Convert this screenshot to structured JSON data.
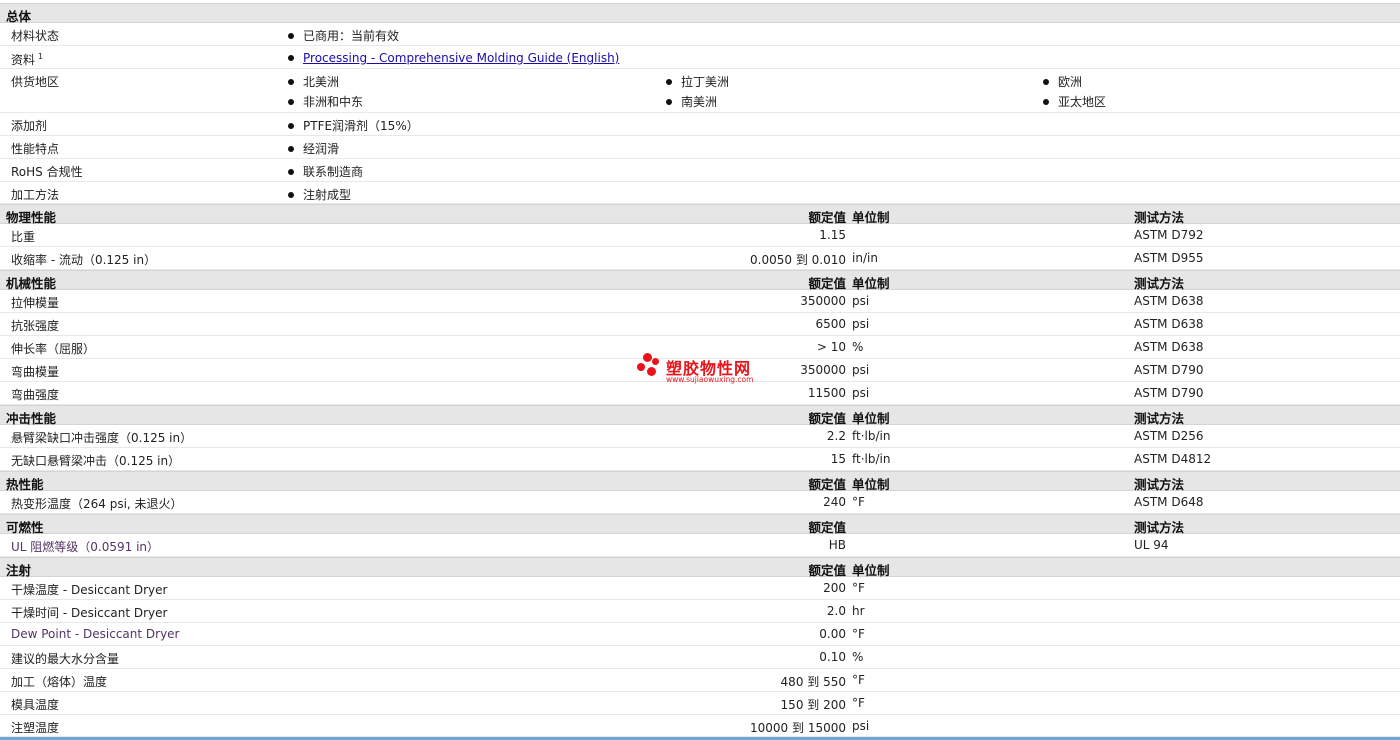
{
  "sections": {
    "general": "总体",
    "physical": "物理性能",
    "mechanical": "机械性能",
    "impact": "冲击性能",
    "thermal": "热性能",
    "flammability": "可燃性",
    "injection": "注射"
  },
  "columns": {
    "rated_value": "额定值",
    "unit_system": "单位制",
    "test_method": "测试方法"
  },
  "general": {
    "material_status_label": "材料状态",
    "material_status_value": "已商用：当前有效",
    "documents_label": "资料",
    "documents_sup": "1",
    "documents_link": "Processing - Comprehensive Molding Guide (English)",
    "regions_label": "供货地区",
    "regions": [
      "北美洲",
      "拉丁美洲",
      "欧洲",
      "非洲和中东",
      "南美洲",
      "亚太地区"
    ],
    "additive_label": "添加剂",
    "additive_value": "PTFE润滑剂（15%）",
    "features_label": "性能特点",
    "features_value": "经润滑",
    "rohs_label": "RoHS 合规性",
    "rohs_value": "联系制造商",
    "processing_label": "加工方法",
    "processing_value": "注射成型"
  },
  "physical_rows": [
    {
      "label": "比重",
      "value": "1.15",
      "unit": "",
      "method": "ASTM D792"
    },
    {
      "label": "收缩率  - 流动（0.125 in）",
      "value": "0.0050 到  0.010",
      "unit": "in/in",
      "method": "ASTM D955"
    }
  ],
  "mechanical_rows": [
    {
      "label": "拉伸模量",
      "value": "350000",
      "unit": "psi",
      "method": "ASTM D638"
    },
    {
      "label": "抗张强度",
      "value": "6500",
      "unit": "psi",
      "method": "ASTM D638"
    },
    {
      "label": "伸长率（屈服）",
      "value": "> 10",
      "unit": "%",
      "method": "ASTM D638"
    },
    {
      "label": "弯曲模量",
      "value": "350000",
      "unit": "psi",
      "method": "ASTM D790"
    },
    {
      "label": "弯曲强度",
      "value": "11500",
      "unit": "psi",
      "method": "ASTM D790"
    }
  ],
  "impact_rows": [
    {
      "label": "悬臂梁缺口冲击强度（0.125 in）",
      "value": "2.2",
      "unit": "ft·lb/in",
      "method": "ASTM D256"
    },
    {
      "label": "无缺口悬臂梁冲击（0.125 in）",
      "value": "15",
      "unit": "ft·lb/in",
      "method": "ASTM D4812"
    }
  ],
  "thermal_rows": [
    {
      "label": "热变形温度（264 psi, 未退火）",
      "value": "240",
      "unit": "°F",
      "method": "ASTM D648"
    }
  ],
  "flammability_rows": [
    {
      "label": "UL 阻燃等级（0.0591 in）",
      "value": "HB",
      "unit": "",
      "method": "UL 94"
    }
  ],
  "injection_rows": [
    {
      "label": "干燥温度  - Desiccant Dryer",
      "value": "200",
      "unit": "°F"
    },
    {
      "label": "干燥时间  - Desiccant Dryer",
      "value": "2.0",
      "unit": "hr"
    },
    {
      "label": "Dew Point - Desiccant Dryer",
      "value": "0.00",
      "unit": "°F"
    },
    {
      "label": "建议的最大水分含量",
      "value": "0.10",
      "unit": "%"
    },
    {
      "label": "加工（熔体）温度",
      "value": "480 到  550",
      "unit": "°F"
    },
    {
      "label": "模具温度",
      "value": "150 到  200",
      "unit": "°F"
    },
    {
      "label": "注塑温度",
      "value": "10000 到  15000",
      "unit": "psi"
    }
  ],
  "watermark": {
    "title": "塑胶物性网",
    "url": "www.sujiaowuxing.com"
  }
}
